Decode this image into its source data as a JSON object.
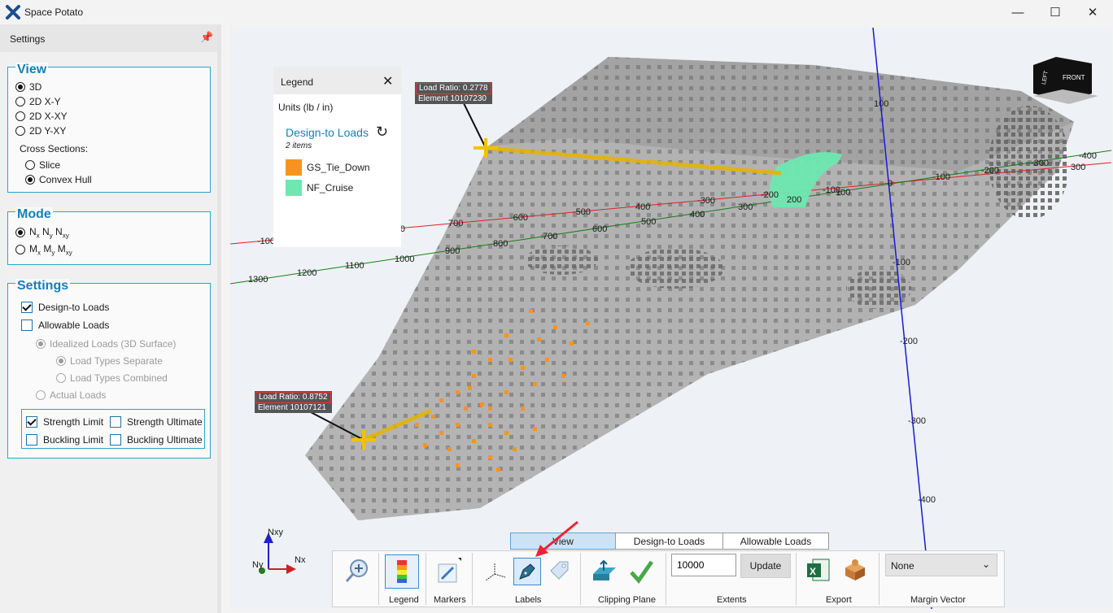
{
  "window": {
    "title": "Space Potato",
    "colors": {
      "accent": "#1580b8",
      "group_border": "#2ca5c7"
    }
  },
  "settings_panel": {
    "title": "Settings",
    "view": {
      "title": "View",
      "options": [
        "3D",
        "2D X-Y",
        "2D X-XY",
        "2D Y-XY"
      ],
      "selected": "3D",
      "cross_sections_label": "Cross Sections:",
      "cross_sections": [
        "Slice",
        "Convex Hull"
      ],
      "cross_selected": "Convex Hull"
    },
    "mode": {
      "title": "Mode",
      "options": [
        {
          "base": [
            "N",
            "N",
            "N"
          ],
          "subs": [
            "x",
            "y",
            "xy"
          ]
        },
        {
          "base": [
            "M",
            "M",
            "M"
          ],
          "subs": [
            "x",
            "y",
            "xy"
          ]
        }
      ],
      "selected_index": 0
    },
    "settings": {
      "title": "Settings",
      "design_to_loads": "Design-to Loads",
      "allowable_loads": "Allowable Loads",
      "idealized_loads": "Idealized Loads (3D Surface)",
      "load_types_separate": "Load Types Separate",
      "load_types_combined": "Load Types Combined",
      "actual_loads": "Actual Loads",
      "strength_limit": "Strength Limit",
      "strength_ultimate": "Strength Ultimate",
      "buckling_limit": "Buckling Limit",
      "buckling_ultimate": "Buckling Ultimate"
    }
  },
  "legend": {
    "title": "Legend",
    "units": "Units (lb / in)",
    "heading": "Design-to Loads",
    "count": "2 items",
    "items": [
      {
        "label": "GS_Tie_Down",
        "color": "#f7941d"
      },
      {
        "label": "NF_Cruise",
        "color": "#6ee8b0"
      }
    ]
  },
  "callouts": [
    {
      "ratio": "Load Ratio: 0.2778",
      "element": "Element 10107230"
    },
    {
      "ratio": "Load Ratio: 0.8752",
      "element": "Element 10107121"
    }
  ],
  "view_cube": {
    "left": "LEFT",
    "front": "FRONT"
  },
  "axis_labels": {
    "red": [
      "-100",
      "-900",
      "-800",
      "700",
      "-600",
      "-500",
      "400",
      "-300",
      "-200",
      "-100",
      "0",
      "-100",
      "-200",
      "-300",
      "-400"
    ],
    "green": [
      "1300",
      "1200",
      "1100",
      "1000",
      "900",
      "800",
      "700",
      "600",
      "500",
      "400",
      "300",
      "200",
      "100",
      "300"
    ],
    "blue": [
      "100",
      "-100",
      "-200",
      "-300",
      "-400"
    ]
  },
  "gizmo": {
    "up": "Nxy",
    "right": "Nx",
    "left": "Ny"
  },
  "tabs": [
    "View",
    "Design-to Loads",
    "Allowable Loads"
  ],
  "active_tab": "View",
  "toolbar": {
    "legend_label": "Legend",
    "markers_label": "Markers",
    "labels_label": "Labels",
    "clipping_label": "Clipping Plane",
    "extents_value": "10000",
    "update_label": "Update",
    "extents_label": "Extents",
    "export_label": "Export",
    "margin_value": "None",
    "margin_label": "Margin Vector"
  }
}
